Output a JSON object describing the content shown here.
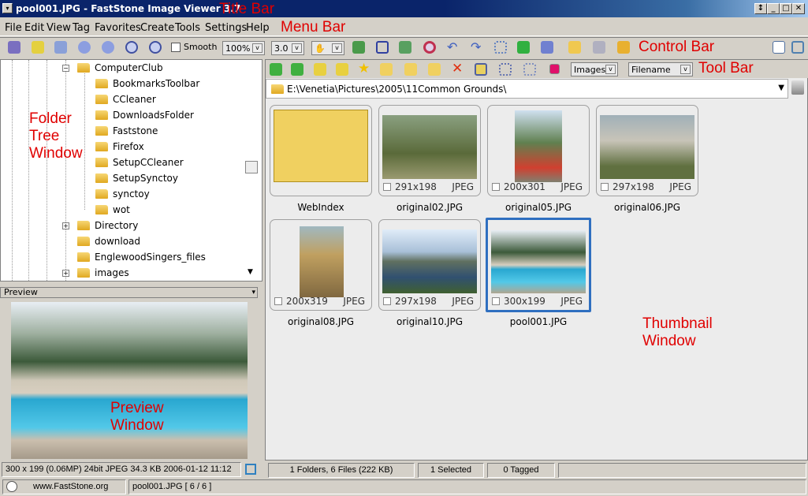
{
  "window": {
    "title": "pool001.JPG  -  FastStone Image Viewer 3.7",
    "controls": [
      "restore",
      "minimize",
      "maximize",
      "close"
    ]
  },
  "menu": [
    "File",
    "Edit",
    "View",
    "Tag",
    "Favorites",
    "Create",
    "Tools",
    "Settings",
    "Help"
  ],
  "controlbar": {
    "smooth_label": "Smooth",
    "smooth_checked": false,
    "zoom": "100%",
    "ratio": "3.0"
  },
  "toolbar": {
    "filter": "Images",
    "sort": "Filename"
  },
  "path": "E:\\Venetia\\Pictures\\2005\\11Common Grounds\\",
  "tree": [
    "ComputerClub",
    "BookmarksToolbar",
    "CCleaner",
    "DownloadsFolder",
    "Faststone",
    "Firefox",
    "SetupCCleaner",
    "SetupSynctoy",
    "synctoy",
    "wot",
    "Directory",
    "download",
    "EnglewoodSingers_files",
    "images"
  ],
  "preview": {
    "header": "Preview",
    "info": "300 x 199 (0.06MP)   24bit JPEG   34.3 KB   2006-01-12 11:12"
  },
  "thumbnails": [
    {
      "name": "WebIndex",
      "dim": "",
      "fmt": ""
    },
    {
      "name": "original02.JPG",
      "dim": "291x198",
      "fmt": "JPEG"
    },
    {
      "name": "original05.JPG",
      "dim": "200x301",
      "fmt": "JPEG"
    },
    {
      "name": "original06.JPG",
      "dim": "297x198",
      "fmt": "JPEG"
    },
    {
      "name": "original08.JPG",
      "dim": "200x319",
      "fmt": "JPEG"
    },
    {
      "name": "original10.JPG",
      "dim": "297x198",
      "fmt": "JPEG"
    },
    {
      "name": "pool001.JPG",
      "dim": "300x199",
      "fmt": "JPEG"
    }
  ],
  "status": {
    "files": "1 Folders, 6 Files (222 KB)",
    "selected": "1 Selected",
    "tagged": "0 Tagged",
    "website": "www.FastStone.org",
    "current": "pool001.JPG [ 6 / 6 ]"
  },
  "annotations": {
    "title": "Title Bar",
    "menu": "Menu Bar",
    "control": "Control Bar",
    "tool": "Tool Bar",
    "folder": "Folder\nTree\nWindow",
    "preview": "Preview\nWindow",
    "thumbnail": "Thumbnail\nWindow"
  }
}
